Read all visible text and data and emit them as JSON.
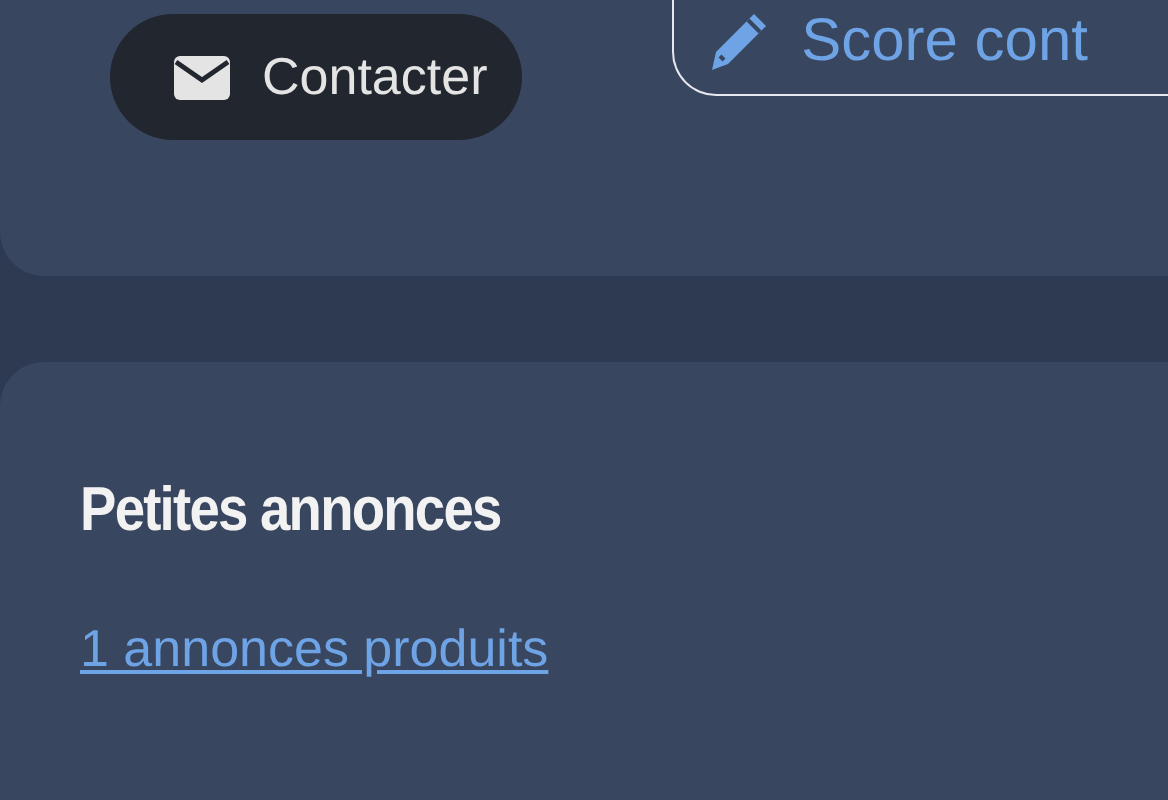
{
  "profile_actions": [
    {
      "kind": "contact",
      "label": "Contacter"
    },
    {
      "kind": "edit",
      "label": "Score cont"
    }
  ],
  "classifieds": {
    "title": "Petites annonces",
    "link": "1 annonces produits"
  }
}
